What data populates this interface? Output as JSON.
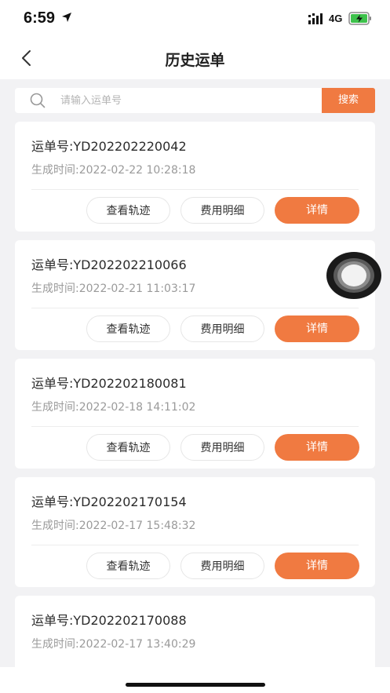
{
  "status_bar": {
    "time": "6:59",
    "network": "4G"
  },
  "nav": {
    "title": "历史运单",
    "back_icon": "chevron-left-icon"
  },
  "search": {
    "placeholder": "请输入运单号",
    "value": "",
    "button_label": "搜索",
    "icon": "search-icon"
  },
  "orders": [
    {
      "number": "运单号:YD202202220042",
      "time": "生成时间:2022-02-22 10:28:18"
    },
    {
      "number": "运单号:YD202202210066",
      "time": "生成时间:2022-02-21 11:03:17"
    },
    {
      "number": "运单号:YD202202180081",
      "time": "生成时间:2022-02-18 14:11:02"
    },
    {
      "number": "运单号:YD202202170154",
      "time": "生成时间:2022-02-17 15:48:32"
    },
    {
      "number": "运单号:YD202202170088",
      "time": "生成时间:2022-02-17 13:40:29"
    }
  ],
  "actions": {
    "track": "查看轨迹",
    "fee": "费用明细",
    "detail": "详情"
  },
  "colors": {
    "accent": "#f07a41",
    "background": "#f2f2f4",
    "muted_text": "#9a9a9a"
  }
}
